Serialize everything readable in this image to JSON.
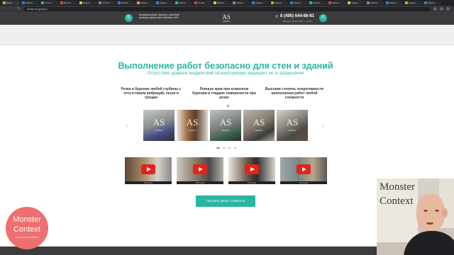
{
  "browser": {
    "tabs": [
      "Monst",
      "Кампан",
      "Статьи",
      "Вопрос",
      "Яндекс",
      "Статист",
      "Кампан",
      "Кампан",
      "Кампан",
      "Кампан",
      "Гео Re",
      "Кампан",
      "Кампан",
      "Кампан",
      "Кампан",
      "Кампан",
      "Кампан",
      "Кампан",
      "Кампан",
      "Кампан",
      "Кампан",
      "Кампан",
      "Кампан"
    ],
    "active_tab_index": 0,
    "url": "almaz-rez-group.ru"
  },
  "header": {
    "menu_icon": "hamburger-icon",
    "tagline": "Алмазная резка, бурение, усиление проемов, демонтаж в Москве и МО",
    "logo_mark": "AS",
    "logo_sub": "GROUP",
    "phone": "8 (495) 644-86-81",
    "hours": "Звоните Пн-Вс: 8:00 — 21:00",
    "callback_icon": "phone-icon"
  },
  "section": {
    "title": "Выполнение работ безопасно для стен и зданий",
    "subtitle": "Отсутствие ударных воздействий на конструкцию защищает ее от разрушения",
    "features": [
      "Резка и бурение любой глубины с отсутствием вибраций, пыли и трещин",
      "Ровные края при алмазном бурении и гладкие поверхности при резке",
      "Высокая степень оперативности выполнения работ любой сложности"
    ],
    "gallery_watermark": "AS",
    "gallery_watermark_sub": "GROUP",
    "videos": [
      {
        "caption": "AS Group"
      },
      {
        "caption": "AS Group"
      },
      {
        "caption": "AS Group"
      },
      {
        "caption": "AS Group"
      }
    ],
    "cta_label": "Получить расчет стоимости"
  },
  "overlay": {
    "logo_line1": "Monster",
    "logo_line2": "Context",
    "logo_line3": "by Konstantin Loshkarev",
    "poster_line1": "Monster",
    "poster_line2": "Context"
  },
  "colors": {
    "accent": "#2ab5a0",
    "header_bg": "#3c3c3c",
    "overlay_logo": "#ee6f6f"
  }
}
